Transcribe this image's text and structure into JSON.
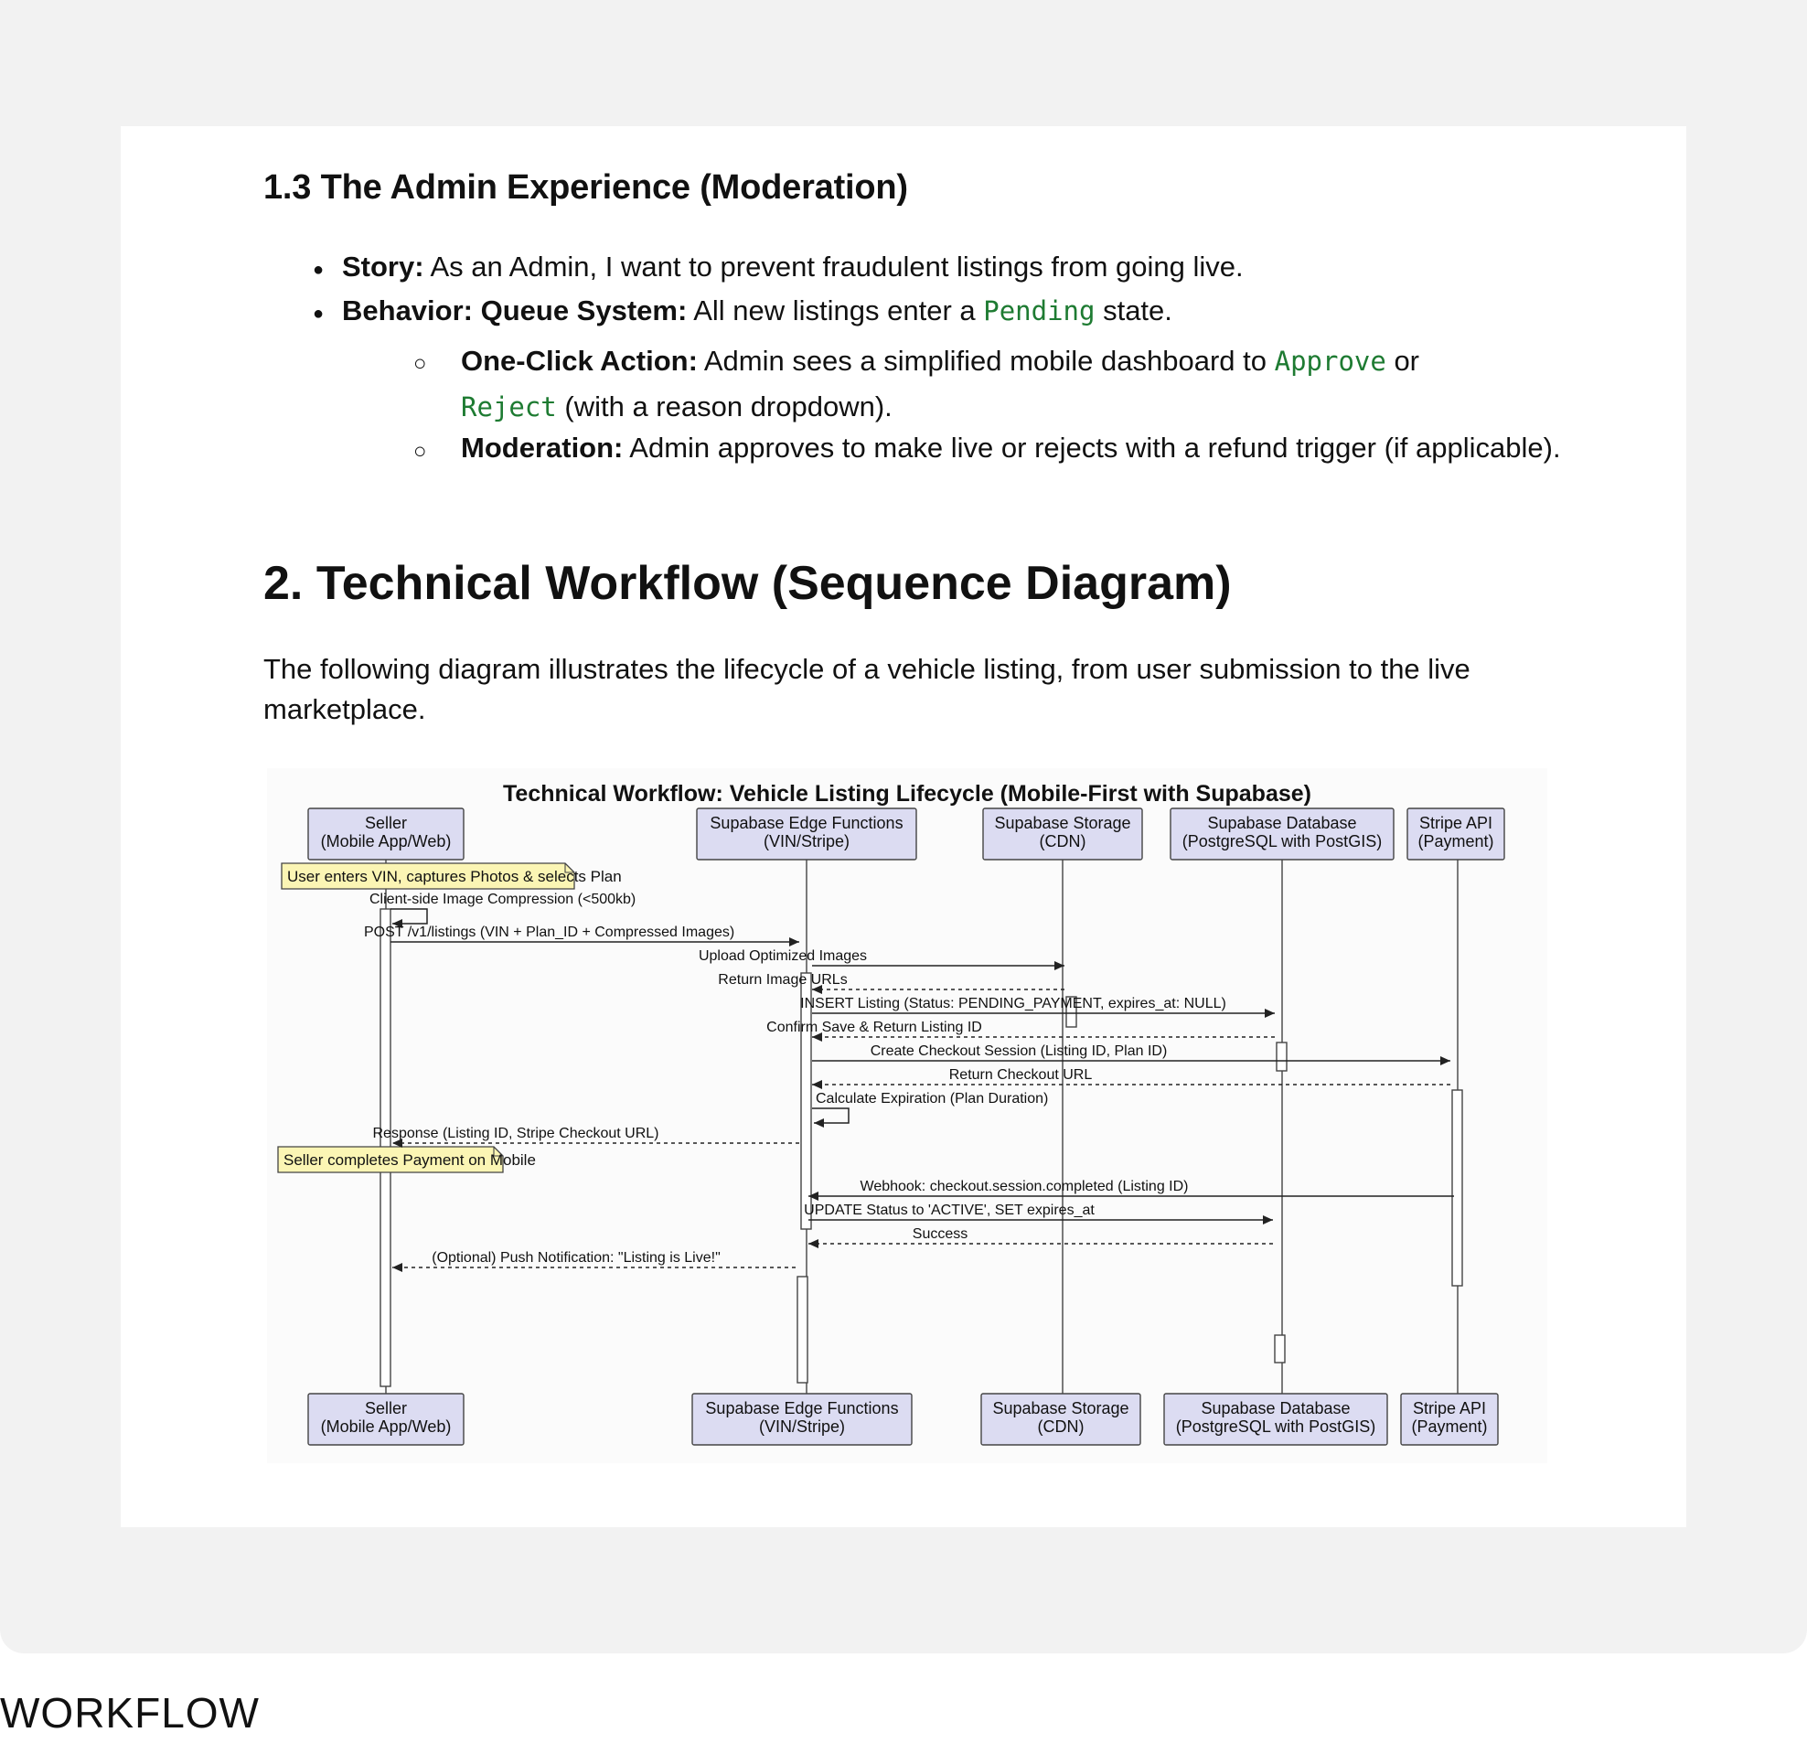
{
  "section13": {
    "title": "1.3 The Admin Experience (Moderation)",
    "story_label": "Story:",
    "story_text": " As an Admin, I want to prevent fraudulent listings from going live.",
    "behavior_label": "Behavior: Queue System:",
    "behavior_text_1": " All new listings enter a ",
    "behavior_code": "Pending",
    "behavior_text_2": " state.",
    "oneclick_label": "One-Click Action:",
    "oneclick_text_1": " Admin sees a simplified mobile dashboard to ",
    "oneclick_code_1": "Approve",
    "oneclick_text_2": " or ",
    "oneclick_code_2": "Reject",
    "oneclick_text_3": " (with a reason dropdown).",
    "moderation_label": "Moderation:",
    "moderation_text": " Admin approves to make live or rejects with a refund trigger (if applicable)."
  },
  "section2": {
    "title": "2. Technical Workflow (Sequence Diagram)",
    "paragraph": "The following diagram illustrates the lifecycle of a vehicle listing, from user submission to the live marketplace."
  },
  "diagram": {
    "title": "Technical Workflow: Vehicle Listing Lifecycle (Mobile-First with Supabase)",
    "participants": [
      {
        "line1": "Seller",
        "line2": "(Mobile App/Web)"
      },
      {
        "line1": "Supabase Edge Functions",
        "line2": "(VIN/Stripe)"
      },
      {
        "line1": "Supabase Storage",
        "line2": "(CDN)"
      },
      {
        "line1": "Supabase Database",
        "line2": "(PostgreSQL with PostGIS)"
      },
      {
        "line1": "Stripe API",
        "line2": "(Payment)"
      }
    ],
    "notes": [
      "User enters VIN, captures Photos & selects Plan",
      "Seller completes Payment on Mobile"
    ],
    "messages": [
      "Client-side Image Compression (<500kb)",
      "POST /v1/listings (VIN + Plan_ID + Compressed Images)",
      "Upload Optimized Images",
      "Return Image URLs",
      "INSERT Listing (Status: PENDING_PAYMENT, expires_at: NULL)",
      "Confirm Save & Return Listing ID",
      "Create Checkout Session (Listing ID, Plan ID)",
      "Return Checkout URL",
      "Calculate Expiration (Plan Duration)",
      "Response (Listing ID, Stripe Checkout URL)",
      "Webhook: checkout.session.completed (Listing ID)",
      "UPDATE Status to 'ACTIVE', SET expires_at",
      "Success",
      "(Optional) Push Notification: \"Listing is Live!\""
    ]
  },
  "caption": "WORKFLOW",
  "colors": {
    "code_green": "#1e7b32",
    "participant_fill": "#dcdcf2",
    "note_fill": "#fbf5b4",
    "frame_bg": "#f2f2f2"
  }
}
